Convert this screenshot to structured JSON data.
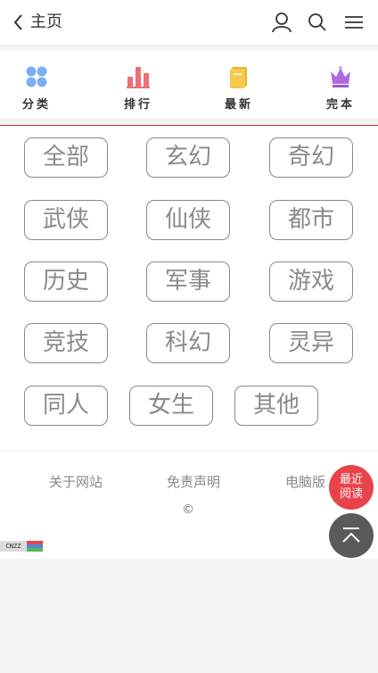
{
  "header": {
    "back_label": "主页",
    "icons": [
      "back-chevron-icon",
      "user-icon",
      "search-icon",
      "menu-icon"
    ]
  },
  "nav": {
    "items": [
      {
        "label": "分类",
        "icon": "category-dots-icon"
      },
      {
        "label": "排行",
        "icon": "ranking-bars-icon"
      },
      {
        "label": "最新",
        "icon": "newest-book-icon"
      },
      {
        "label": "完本",
        "icon": "crown-icon"
      }
    ]
  },
  "categories": [
    "全部",
    "玄幻",
    "奇幻",
    "武侠",
    "仙侠",
    "都市",
    "历史",
    "军事",
    "游戏",
    "竞技",
    "科幻",
    "灵异",
    "同人",
    "女生",
    "其他"
  ],
  "footer": {
    "links": [
      "关于网站",
      "免责声明",
      "电脑版"
    ],
    "copyright": "©",
    "cnzz_label": "CNZZ"
  },
  "floating": {
    "recent_line1": "最近",
    "recent_line2": "阅读",
    "back_to_top_icon": "arrow-up-icon"
  },
  "colors": {
    "accent_red": "#e8434b",
    "divider_red": "#c8333f",
    "category_border": "#8a8a8a",
    "nav_blue": "#7aaef5",
    "nav_pink": "#ee6f74",
    "nav_yellow": "#f5c94a",
    "nav_purple": "#b06be0"
  }
}
